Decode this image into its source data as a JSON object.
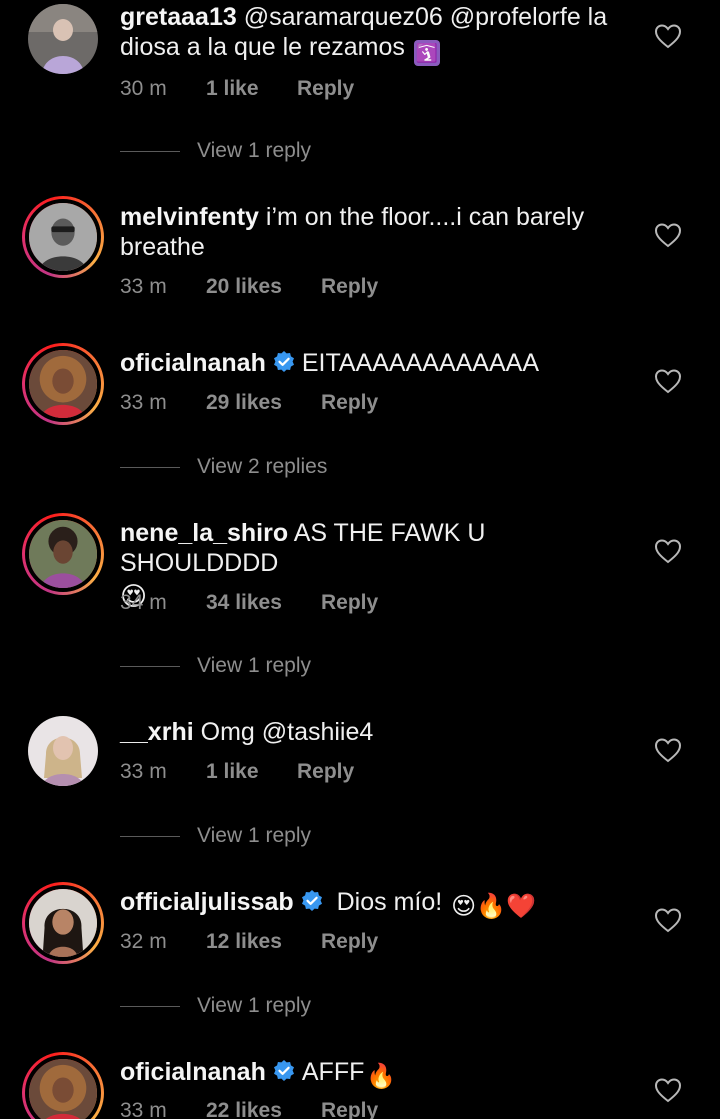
{
  "comments": [
    {
      "username": "gretaaa13",
      "text": " @saramarquez06  @profelorfe  la diosa a la que le rezamos",
      "emoji": "🛐",
      "time": "30 m",
      "likes": "1 like",
      "reply": "Reply",
      "view_replies": "View 1 reply"
    },
    {
      "username": "melvinfenty",
      "text": " i’m on the floor....i can barely breathe",
      "time": "33 m",
      "likes": "20 likes",
      "reply": "Reply"
    },
    {
      "username": "oficialnanah",
      "text": "EITAAAAAAAAAAAA",
      "time": "33 m",
      "likes": "29 likes",
      "reply": "Reply",
      "view_replies": "View 2 replies"
    },
    {
      "username": "nene_la_shiro",
      "text": " AS THE FAWK U SHOULDDDD",
      "emoji": "😍",
      "time": "34 m",
      "likes": "34 likes",
      "reply": "Reply",
      "view_replies": "View 1 reply"
    },
    {
      "username": "__xrhi",
      "text": " Omg @tashiie4",
      "time": "33 m",
      "likes": "1 like",
      "reply": "Reply",
      "view_replies": "View 1 reply"
    },
    {
      "username": "officialjulissab",
      "text": " Dios mío! ",
      "emoji": "😍🔥❤️",
      "time": "32 m",
      "likes": "12 likes",
      "reply": "Reply",
      "view_replies": "View 1 reply"
    },
    {
      "username": "oficialnanah",
      "text": "AFFF",
      "emoji": "🔥",
      "time": "33 m",
      "likes": "22 likes",
      "reply": "Reply"
    }
  ],
  "colors": {
    "background": "#000000",
    "text": "#f5f5f5",
    "muted": "#8e8e8e",
    "verified": "#3897f0"
  }
}
